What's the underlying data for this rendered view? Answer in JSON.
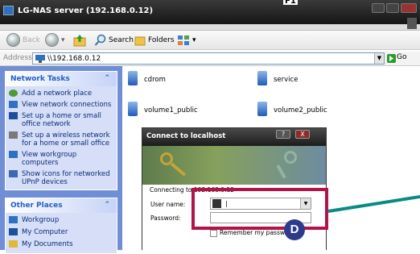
{
  "window": {
    "title": "LG-NAS server (192.168.0.12)",
    "corner_mark": "F1"
  },
  "toolbar": {
    "back_label": "Back",
    "search_label": "Search",
    "folders_label": "Folders"
  },
  "address": {
    "label": "Address",
    "value": "\\\\192.168.0.12",
    "go_label": "Go"
  },
  "network_tasks": {
    "header": "Network Tasks",
    "items": [
      "Add a network place",
      "View network connections",
      "Set up a home or small office network",
      "Set up a wireless network for a home or small office",
      "View workgroup computers",
      "Show icons for networked UPnP devices"
    ]
  },
  "other_places": {
    "header": "Other Places",
    "items": [
      "Workgroup",
      "My Computer",
      "My Documents"
    ]
  },
  "files": [
    "cdrom",
    "service",
    "volume1_public",
    "volume2_public"
  ],
  "dialog": {
    "title": "Connect to localhost",
    "connecting": "Connecting to 192.168.0.12",
    "user_label": "User name:",
    "password_label": "Password:",
    "remember_label": "Remember my password",
    "help_btn": "?",
    "close_btn": "X"
  },
  "annotation": {
    "marker": "D",
    "highlight_color": "#b5124a",
    "marker_color": "#2e3a8c",
    "arrow_color": "#0a8a85"
  }
}
